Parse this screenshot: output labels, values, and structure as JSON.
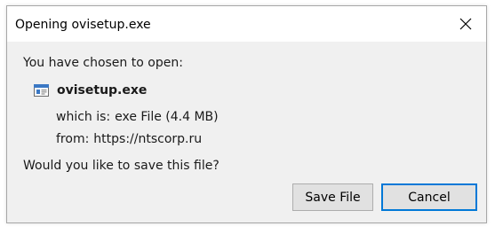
{
  "window": {
    "title": "Opening ovisetup.exe"
  },
  "dialog": {
    "lead_text": "You have chosen to open:",
    "file_name": "ovisetup.exe",
    "which_is_label": "which is:",
    "which_is_value": "exe File (4.4 MB)",
    "from_label": "from:",
    "from_value": "https://ntscorp.ru",
    "question": "Would you like to save this file?"
  },
  "buttons": {
    "save_label": "Save File",
    "cancel_label": "Cancel"
  },
  "icons": {
    "close": "close-icon",
    "file": "executable-file-icon"
  },
  "colors": {
    "dialog_bg": "#f0f0f0",
    "titlebar_bg": "#ffffff",
    "default_button_border": "#0078d7",
    "button_bg": "#e1e1e1"
  }
}
